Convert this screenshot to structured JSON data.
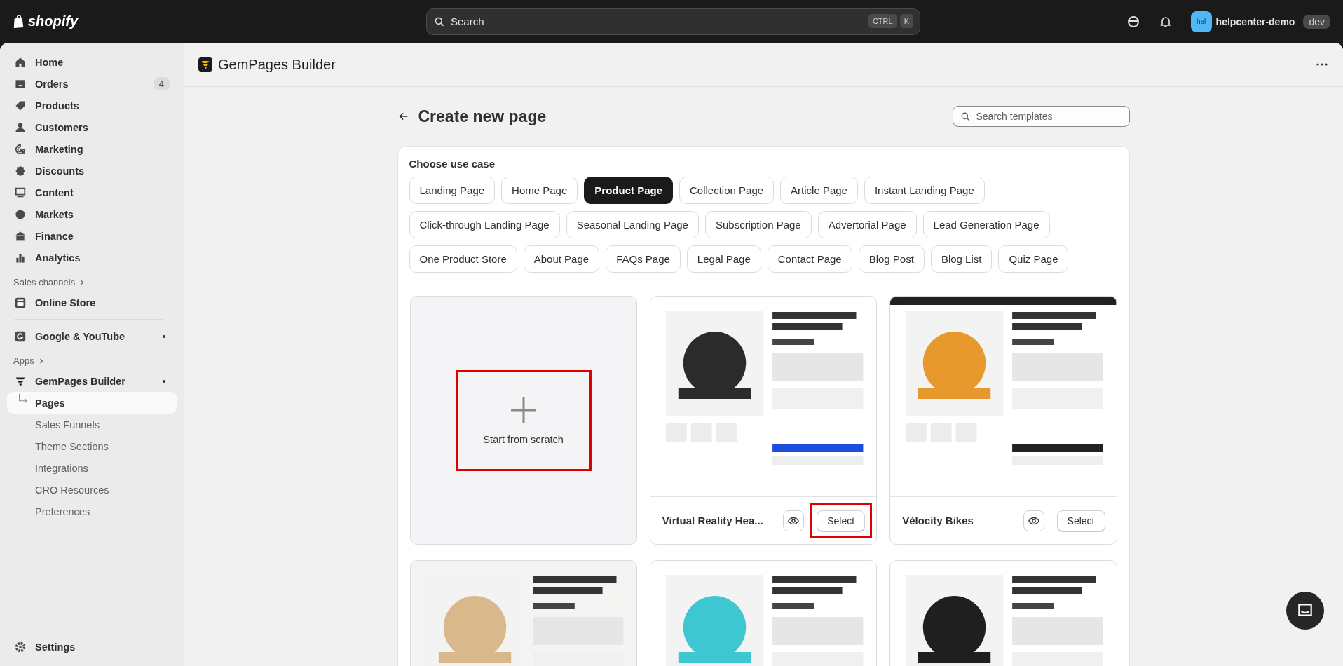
{
  "topbar": {
    "logo": "shopify",
    "search": {
      "placeholder": "Search",
      "keys": [
        "CTRL",
        "K"
      ]
    },
    "user": {
      "avatar": "hel",
      "name": "helpcenter-demo",
      "badge": "dev"
    }
  },
  "sidebar": {
    "nav": [
      {
        "label": "Home"
      },
      {
        "label": "Orders",
        "badge": "4"
      },
      {
        "label": "Products"
      },
      {
        "label": "Customers"
      },
      {
        "label": "Marketing"
      },
      {
        "label": "Discounts"
      },
      {
        "label": "Content"
      },
      {
        "label": "Markets"
      },
      {
        "label": "Finance"
      },
      {
        "label": "Analytics"
      }
    ],
    "sales_channels": {
      "heading": "Sales channels",
      "items": [
        {
          "label": "Online Store"
        }
      ]
    },
    "extra": [
      {
        "label": "Google & YouTube"
      }
    ],
    "apps": {
      "heading": "Apps",
      "app": {
        "label": "GemPages Builder",
        "children": [
          {
            "label": "Pages",
            "selected": true
          },
          {
            "label": "Sales Funnels",
            "selected": false
          },
          {
            "label": "Theme Sections",
            "selected": false
          },
          {
            "label": "Integrations",
            "selected": false
          },
          {
            "label": "CRO Resources",
            "selected": false
          },
          {
            "label": "Preferences",
            "selected": false
          }
        ]
      }
    },
    "settings": "Settings"
  },
  "app_header": {
    "title": "GemPages Builder"
  },
  "page": {
    "title": "Create new page",
    "search": {
      "placeholder": "Search templates"
    }
  },
  "use_case": {
    "heading": "Choose use case",
    "chips": [
      {
        "label": "Landing Page",
        "selected": false
      },
      {
        "label": "Home Page",
        "selected": false
      },
      {
        "label": "Product Page",
        "selected": true
      },
      {
        "label": "Collection Page",
        "selected": false
      },
      {
        "label": "Article Page",
        "selected": false
      },
      {
        "label": "Instant Landing Page",
        "selected": false
      },
      {
        "label": "Click-through Landing Page",
        "selected": false
      },
      {
        "label": "Seasonal Landing Page",
        "selected": false
      },
      {
        "label": "Subscription Page",
        "selected": false
      },
      {
        "label": "Advertorial Page",
        "selected": false
      },
      {
        "label": "Lead Generation Page",
        "selected": false
      },
      {
        "label": "One Product Store",
        "selected": false
      },
      {
        "label": "About Page",
        "selected": false
      },
      {
        "label": "FAQs Page",
        "selected": false
      },
      {
        "label": "Legal Page",
        "selected": false
      },
      {
        "label": "Contact Page",
        "selected": false
      },
      {
        "label": "Blog Post",
        "selected": false
      },
      {
        "label": "Blog List",
        "selected": false
      },
      {
        "label": "Quiz Page",
        "selected": false
      }
    ]
  },
  "templates": [
    {
      "kind": "scratch",
      "label": "Start from scratch",
      "highlighted": true
    },
    {
      "kind": "template",
      "name": "Virtual Reality Hea...",
      "select": "Select",
      "highlighted": true
    },
    {
      "kind": "template",
      "name": "Vélocity Bikes",
      "select": "Select",
      "highlighted": false
    },
    {
      "kind": "preview"
    },
    {
      "kind": "preview"
    },
    {
      "kind": "preview"
    }
  ]
}
